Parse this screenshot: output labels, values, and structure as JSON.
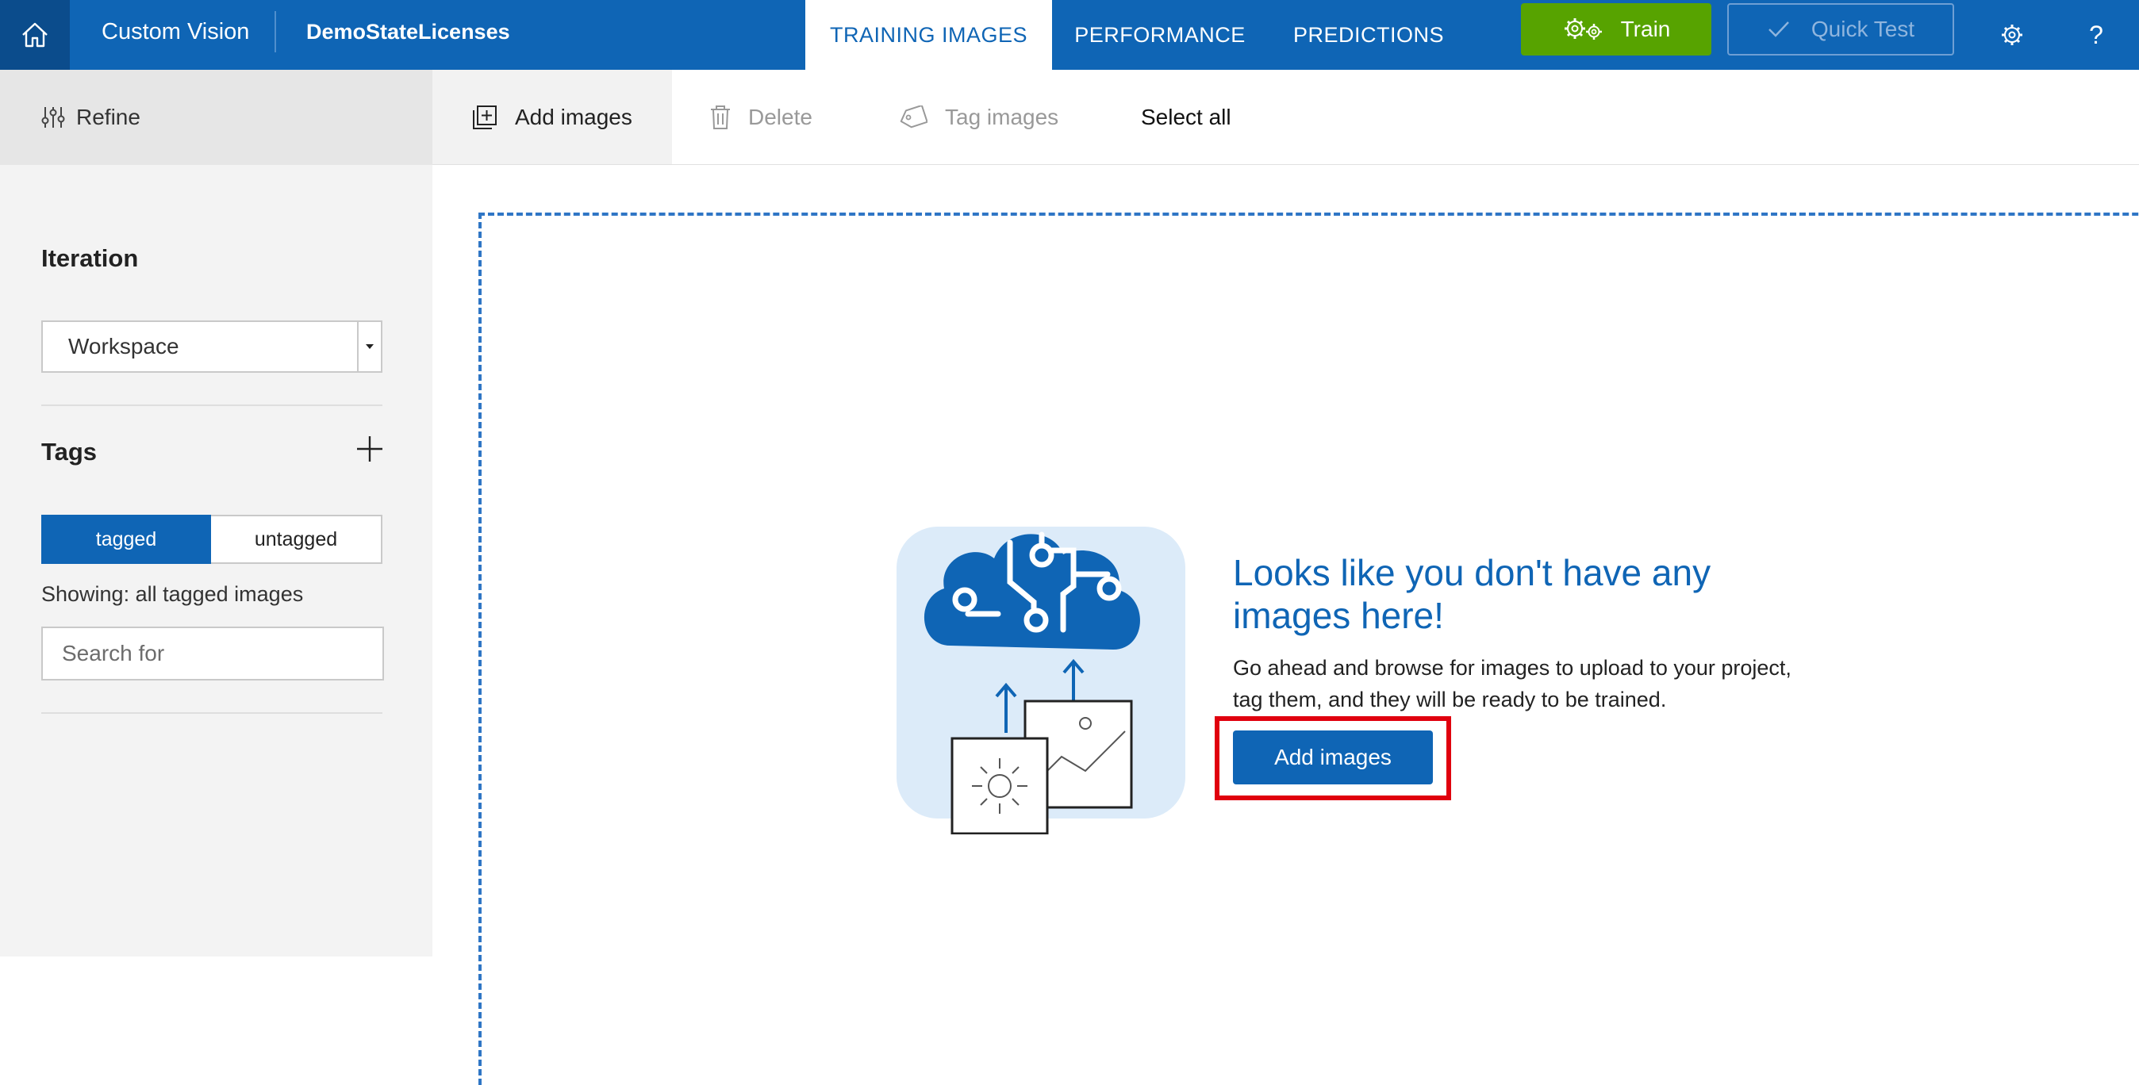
{
  "header": {
    "app_name": "Custom Vision",
    "project_name": "DemoStateLicenses",
    "tabs": [
      {
        "label": "TRAINING IMAGES",
        "active": true
      },
      {
        "label": "PERFORMANCE",
        "active": false
      },
      {
        "label": "PREDICTIONS",
        "active": false
      }
    ],
    "train_label": "Train",
    "quick_test_label": "Quick Test",
    "help_label": "?",
    "brand_color": "#0f65b5",
    "train_color": "#57a300"
  },
  "toolbar": {
    "refine_label": "Refine",
    "add_images_label": "Add images",
    "delete_label": "Delete",
    "tag_images_label": "Tag images",
    "select_all_label": "Select all"
  },
  "sidebar": {
    "iteration_label": "Iteration",
    "iteration_value": "Workspace",
    "tags_label": "Tags",
    "filter": {
      "tagged": "tagged",
      "untagged": "untagged",
      "selected": "tagged"
    },
    "showing_text": "Showing: all tagged images",
    "search_placeholder": "Search for"
  },
  "empty_state": {
    "title": "Looks like you don't have any images here!",
    "description": "Go ahead and browse for images to upload to your project, tag them, and they will be ready to be trained.",
    "button_label": "Add images",
    "highlight_color": "#e0000e"
  }
}
